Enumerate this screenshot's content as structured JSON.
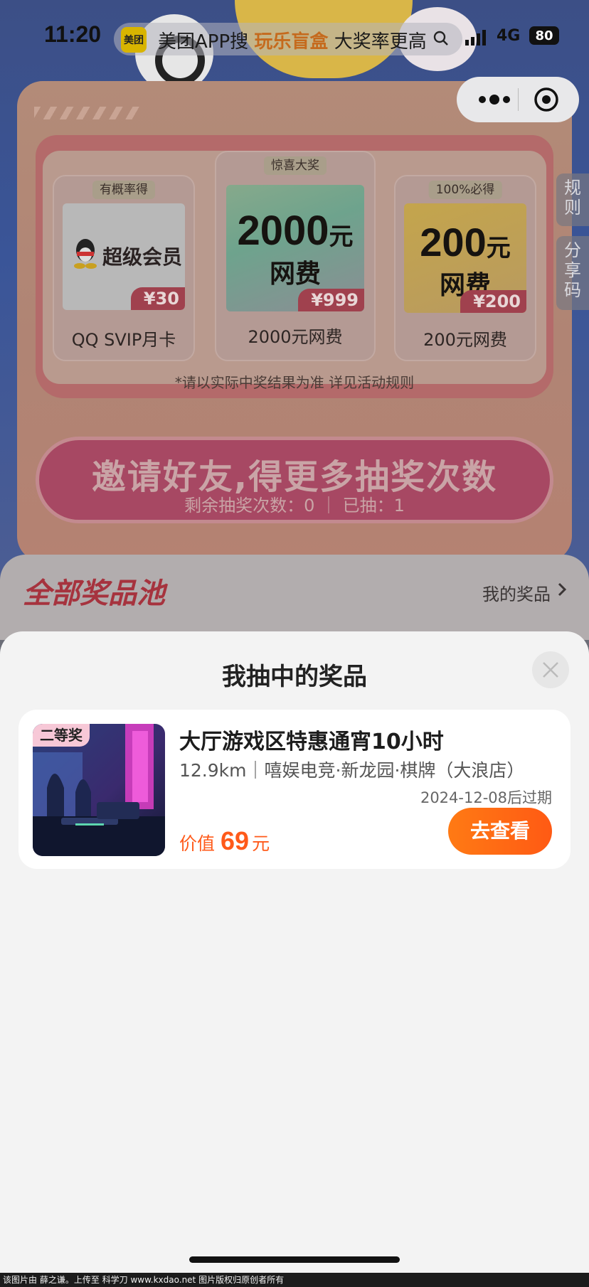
{
  "status_bar": {
    "time": "11:20",
    "network": "4G",
    "battery": "80"
  },
  "search": {
    "logo_text": "美团",
    "prefix": "美团APP搜",
    "highlight": "玩乐盲盒",
    "suffix": "大奖率更高"
  },
  "side_tabs": {
    "rules": "规则",
    "share_code": "分享码"
  },
  "prizes": [
    {
      "tag": "有概率得",
      "image_text": "超级会员",
      "price": "¥30",
      "name": "QQ SVIP月卡"
    },
    {
      "tag": "惊喜大奖",
      "amount": "2000",
      "amount_unit": "元",
      "sub": "网费",
      "price": "¥999",
      "name": "2000元网费"
    },
    {
      "tag": "100%必得",
      "amount": "200",
      "amount_unit": "元",
      "sub": "网费",
      "price": "¥200",
      "name": "200元网费"
    }
  ],
  "disclaimer": "*请以实际中奖结果为准 详见活动规则",
  "invite": {
    "title": "邀请好友,得更多抽奖次数",
    "stats": "剩余抽奖次数：0 ｜ 已抽：1"
  },
  "pool": {
    "title": "全部奖品池",
    "my_prizes": "我的奖品"
  },
  "sheet": {
    "title": "我抽中的奖品",
    "item": {
      "badge": "二等奖",
      "title": "大厅游戏区特惠通宵10小时",
      "meta": "12.9km｜嘻娱电竞·新龙园·棋牌（大浪店）",
      "expiry": "2024-12-08后过期",
      "value_label": "价值",
      "value": "69",
      "value_unit": "元",
      "button": "去查看"
    }
  },
  "footer": "该图片由 薛之谦。上传至 科学刀 www.kxdao.net 图片版权归原创者所有",
  "colors": {
    "accent": "#ff5a14",
    "price_red": "#ff5a1a",
    "badge_pink": "#f7c8d7"
  }
}
